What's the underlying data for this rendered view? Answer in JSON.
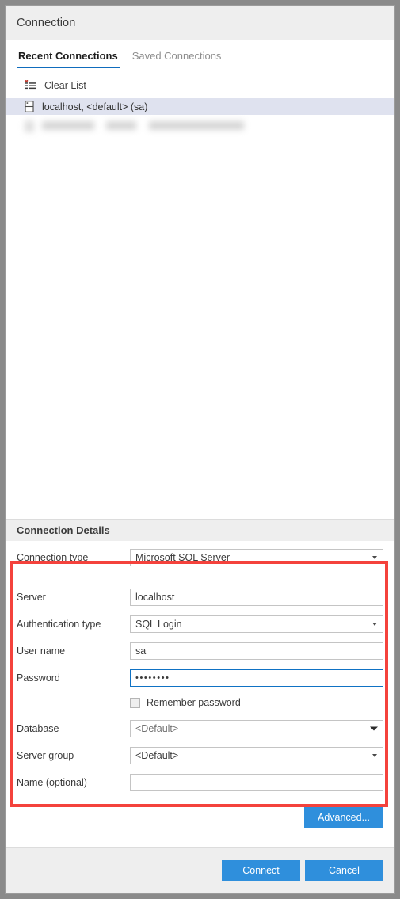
{
  "window": {
    "title": "Connection"
  },
  "tabs": [
    {
      "label": "Recent Connections",
      "active": true
    },
    {
      "label": "Saved Connections",
      "active": false
    }
  ],
  "list": {
    "clear_list_label": "Clear List",
    "clear_list_icon": "clear-list-icon",
    "items": [
      {
        "label": "localhost, <default> (sa)",
        "icon": "server-icon",
        "selected": true,
        "redacted": false
      },
      {
        "label": "",
        "icon": "server-icon",
        "selected": false,
        "redacted": true
      }
    ]
  },
  "details": {
    "header": "Connection Details",
    "fields": [
      {
        "name": "connection-type",
        "label": "Connection type",
        "type": "select",
        "value": "Microsoft SQL Server",
        "caret": "small",
        "placeholder_style": false
      },
      {
        "name": "server",
        "label": "Server",
        "type": "text",
        "value": "localhost",
        "placeholder": "",
        "caret": "none",
        "placeholder_style": false
      },
      {
        "name": "authentication-type",
        "label": "Authentication type",
        "type": "select",
        "value": "SQL Login",
        "caret": "small",
        "placeholder_style": false
      },
      {
        "name": "user-name",
        "label": "User name",
        "type": "text",
        "value": "sa",
        "placeholder": "",
        "caret": "none",
        "placeholder_style": false
      },
      {
        "name": "password",
        "label": "Password",
        "type": "password",
        "value": "••••••••",
        "caret": "none",
        "focused": true,
        "placeholder_style": false
      },
      {
        "name": "database",
        "label": "Database",
        "type": "select",
        "value": "<Default>",
        "caret": "wide",
        "placeholder_style": true
      },
      {
        "name": "server-group",
        "label": "Server group",
        "type": "select",
        "value": "<Default>",
        "caret": "small",
        "placeholder_style": false
      },
      {
        "name": "name-optional",
        "label": "Name (optional)",
        "type": "text",
        "value": "",
        "placeholder": "",
        "caret": "none",
        "placeholder_style": false
      }
    ],
    "remember_password": {
      "label": "Remember password",
      "checked": false
    }
  },
  "buttons": {
    "advanced": "Advanced...",
    "connect": "Connect",
    "cancel": "Cancel"
  },
  "colors": {
    "accent_blue": "#2f8fdc",
    "tab_underline": "#0f6cbd",
    "focus_border": "#0f72c4",
    "annotation_red": "#f4423c",
    "selection": "#dfe2ef",
    "header_gray": "#eeeeee"
  }
}
